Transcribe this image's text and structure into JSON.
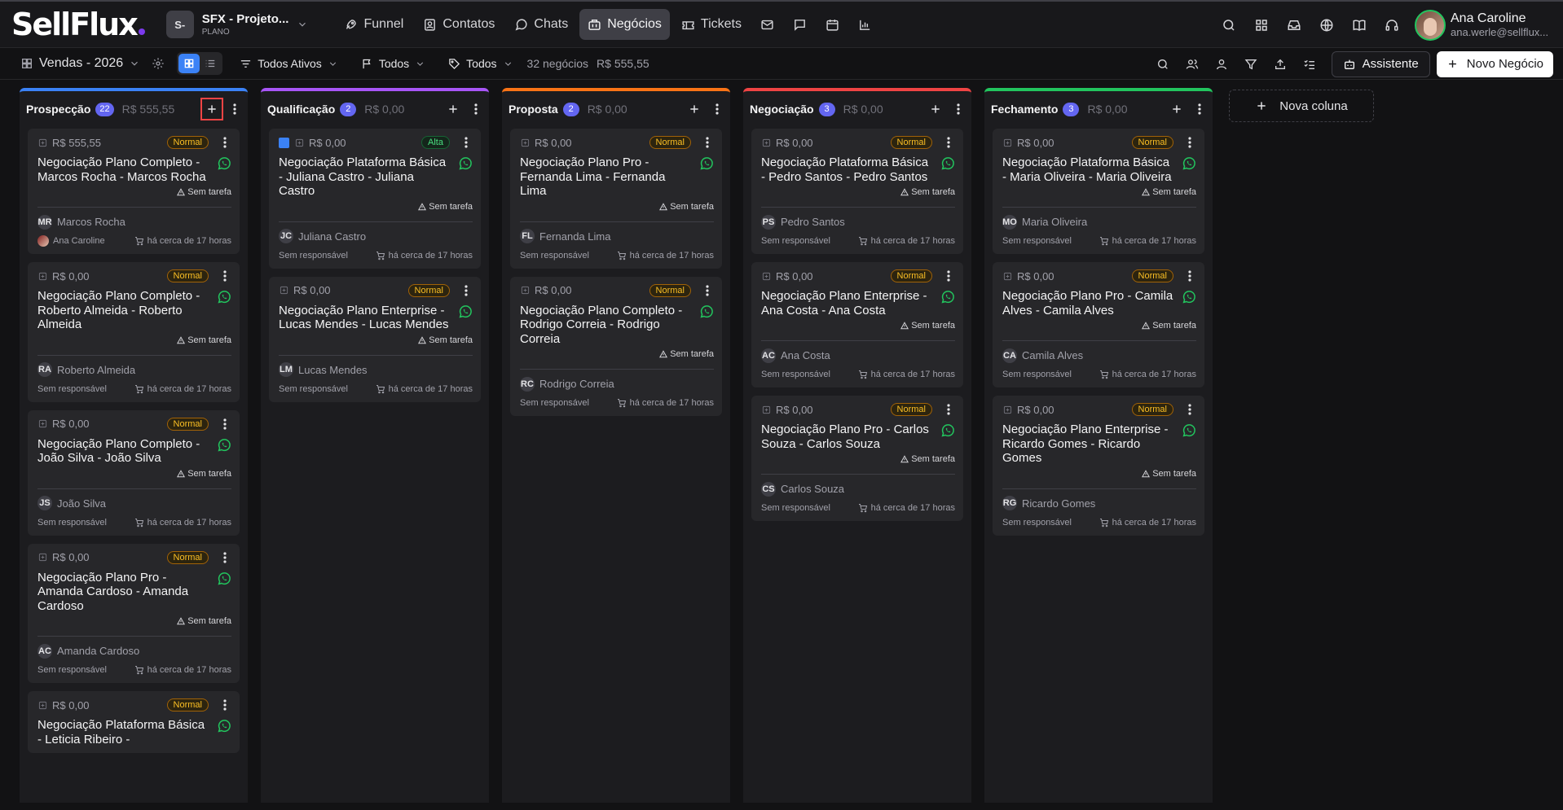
{
  "app": {
    "logo": "SellFlux"
  },
  "workspace": {
    "initials": "S-",
    "name": "SFX - Projeto...",
    "plan": "PLANO"
  },
  "nav": [
    {
      "label": "Funnel",
      "icon": "rocket-icon"
    },
    {
      "label": "Contatos",
      "icon": "contacts-icon"
    },
    {
      "label": "Chats",
      "icon": "chat-bubble-icon"
    },
    {
      "label": "Negócios",
      "icon": "briefcase-icon",
      "active": true
    },
    {
      "label": "Tickets",
      "icon": "ticket-icon"
    }
  ],
  "nav_icons": [
    "mail-icon",
    "message-square-icon",
    "calendar-icon",
    "bar-chart-icon"
  ],
  "top_icons": [
    "search-icon",
    "apps-grid-icon",
    "inbox-icon",
    "globe-icon",
    "book-icon",
    "headset-icon"
  ],
  "user": {
    "name": "Ana Caroline",
    "email": "ana.werle@sellflux..."
  },
  "toolbar": {
    "pipeline": "Vendas - 2026",
    "status_filter": "Todos Ativos",
    "flag_filter": "Todos",
    "tag_filter": "Todos",
    "deals_count": "32 negócios",
    "deals_total": "R$ 555,55",
    "assistant_label": "Assistente",
    "new_deal_label": "Novo Negócio"
  },
  "board": {
    "new_column_label": "Nova coluna",
    "columns": [
      {
        "name": "Prospecção",
        "count": "22",
        "total": "R$ 555,55",
        "color": "#3b82f6",
        "add_highlight": true,
        "cards": [
          {
            "value": "R$ 555,55",
            "priority": "Normal",
            "title": "Negociação Plano Completo - Marcos Rocha - Marcos Rocha",
            "task": "Sem tarefa",
            "initials": "MR",
            "contact": "Marcos Rocha",
            "owner": "Ana Caroline",
            "owner_avatar": true,
            "time": "há cerca de 17 horas"
          },
          {
            "value": "R$ 0,00",
            "priority": "Normal",
            "title": "Negociação Plano Completo - Roberto Almeida - Roberto Almeida",
            "task": "Sem tarefa",
            "initials": "RA",
            "contact": "Roberto Almeida",
            "owner": "Sem responsável",
            "time": "há cerca de 17 horas"
          },
          {
            "value": "R$ 0,00",
            "priority": "Normal",
            "title": "Negociação Plano Completo - João Silva - João Silva",
            "task": "Sem tarefa",
            "initials": "JS",
            "contact": "João Silva",
            "owner": "Sem responsável",
            "time": "há cerca de 17 horas"
          },
          {
            "value": "R$ 0,00",
            "priority": "Normal",
            "title": "Negociação Plano Pro - Amanda Cardoso - Amanda Cardoso",
            "task": "Sem tarefa",
            "initials": "AC",
            "contact": "Amanda Cardoso",
            "owner": "Sem responsável",
            "time": "há cerca de 17 horas"
          },
          {
            "value": "R$ 0,00",
            "priority": "Normal",
            "title": "Negociação Plataforma Básica - Leticia Ribeiro -",
            "task": "",
            "initials": "",
            "contact": "",
            "owner": "",
            "time": ""
          }
        ]
      },
      {
        "name": "Qualificação",
        "count": "2",
        "total": "R$ 0,00",
        "color": "#a855f7",
        "cards": [
          {
            "value": "R$ 0,00",
            "priority": "Alta",
            "checked": true,
            "title": "Negociação Plataforma Básica - Juliana Castro - Juliana Castro",
            "task": "Sem tarefa",
            "initials": "JC",
            "contact": "Juliana Castro",
            "owner": "Sem responsável",
            "time": "há cerca de 17 horas"
          },
          {
            "value": "R$ 0,00",
            "priority": "Normal",
            "title": "Negociação Plano Enterprise - Lucas Mendes - Lucas Mendes",
            "task": "Sem tarefa",
            "initials": "LM",
            "contact": "Lucas Mendes",
            "owner": "Sem responsável",
            "time": "há cerca de 17 horas"
          }
        ]
      },
      {
        "name": "Proposta",
        "count": "2",
        "total": "R$ 0,00",
        "color": "#f97316",
        "cards": [
          {
            "value": "R$ 0,00",
            "priority": "Normal",
            "title": "Negociação Plano Pro - Fernanda Lima - Fernanda Lima",
            "task": "Sem tarefa",
            "initials": "FL",
            "contact": "Fernanda Lima",
            "owner": "Sem responsável",
            "time": "há cerca de 17 horas"
          },
          {
            "value": "R$ 0,00",
            "priority": "Normal",
            "title": "Negociação Plano Completo - Rodrigo Correia - Rodrigo Correia",
            "task": "Sem tarefa",
            "initials": "RC",
            "contact": "Rodrigo Correia",
            "owner": "Sem responsável",
            "time": "há cerca de 17 horas"
          }
        ]
      },
      {
        "name": "Negociação",
        "count": "3",
        "total": "R$ 0,00",
        "color": "#ef4444",
        "cards": [
          {
            "value": "R$ 0,00",
            "priority": "Normal",
            "title": "Negociação Plataforma Básica - Pedro Santos - Pedro Santos",
            "task": "Sem tarefa",
            "initials": "PS",
            "contact": "Pedro Santos",
            "owner": "Sem responsável",
            "time": "há cerca de 17 horas"
          },
          {
            "value": "R$ 0,00",
            "priority": "Normal",
            "title": "Negociação Plano Enterprise - Ana Costa - Ana Costa",
            "task": "Sem tarefa",
            "initials": "AC",
            "contact": "Ana Costa",
            "owner": "Sem responsável",
            "time": "há cerca de 17 horas"
          },
          {
            "value": "R$ 0,00",
            "priority": "Normal",
            "title": "Negociação Plano Pro - Carlos Souza - Carlos Souza",
            "task": "Sem tarefa",
            "initials": "CS",
            "contact": "Carlos Souza",
            "owner": "Sem responsável",
            "time": "há cerca de 17 horas"
          }
        ]
      },
      {
        "name": "Fechamento",
        "count": "3",
        "total": "R$ 0,00",
        "color": "#22c55e",
        "cards": [
          {
            "value": "R$ 0,00",
            "priority": "Normal",
            "title": "Negociação Plataforma Básica - Maria Oliveira - Maria Oliveira",
            "task": "Sem tarefa",
            "initials": "MO",
            "contact": "Maria Oliveira",
            "owner": "Sem responsável",
            "time": "há cerca de 17 horas"
          },
          {
            "value": "R$ 0,00",
            "priority": "Normal",
            "title": "Negociação Plano Pro - Camila Alves - Camila Alves",
            "task": "Sem tarefa",
            "initials": "CA",
            "contact": "Camila Alves",
            "owner": "Sem responsável",
            "time": "há cerca de 17 horas"
          },
          {
            "value": "R$ 0,00",
            "priority": "Normal",
            "title": "Negociação Plano Enterprise - Ricardo Gomes - Ricardo Gomes",
            "task": "Sem tarefa",
            "initials": "RG",
            "contact": "Ricardo Gomes",
            "owner": "Sem responsável",
            "time": "há cerca de 17 horas"
          }
        ]
      }
    ]
  }
}
